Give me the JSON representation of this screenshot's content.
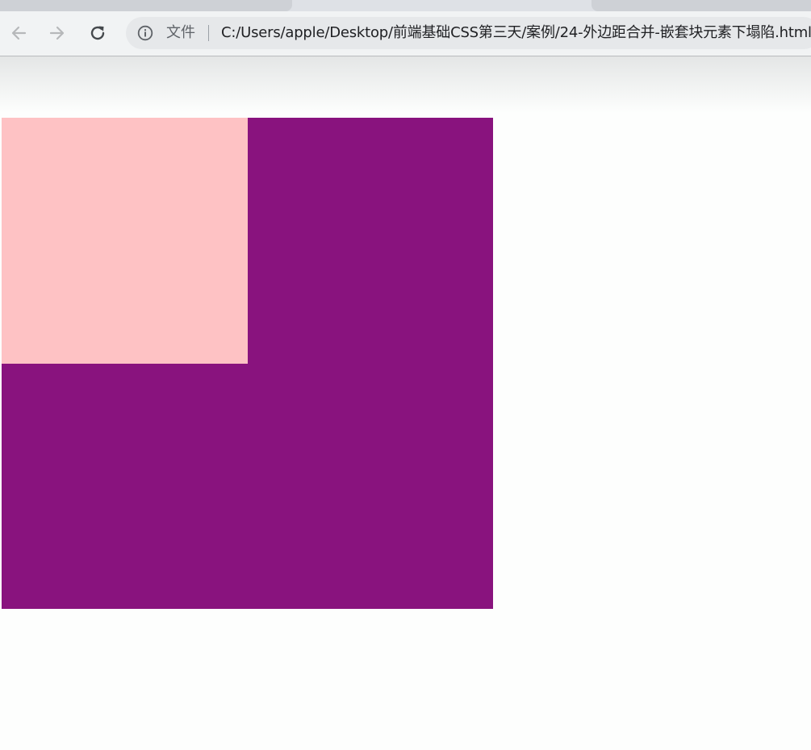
{
  "browser": {
    "address_bar": {
      "scheme_label": "文件",
      "url": "C:/Users/apple/Desktop/前端基础CSS第三天/案例/24-外边距合并-嵌套块元素下塌陷.html"
    },
    "icons": {
      "back": "arrow-left-icon",
      "forward": "arrow-right-icon",
      "reload": "reload-icon",
      "info": "info-icon"
    }
  },
  "page": {
    "outer_box_color": "#89137e",
    "inner_box_color": "#fec2c4",
    "background": "#fdfefd"
  }
}
